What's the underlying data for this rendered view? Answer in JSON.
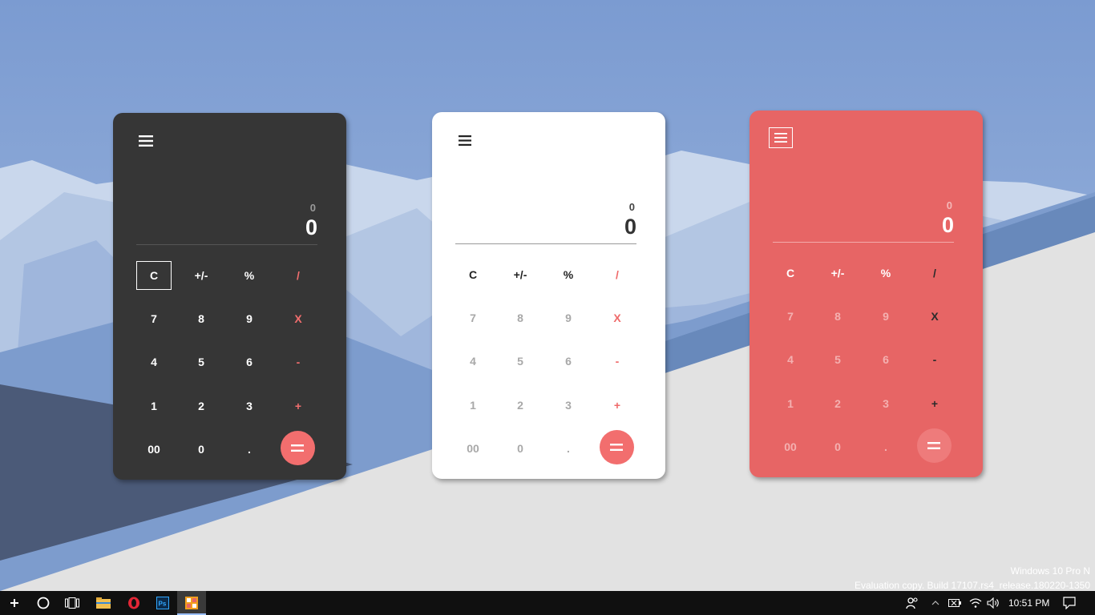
{
  "calculators": [
    {
      "theme": "dark",
      "display": {
        "previous": "0",
        "current": "0"
      },
      "keys": [
        "C",
        "+/-",
        "%",
        "/",
        "7",
        "8",
        "9",
        "X",
        "4",
        "5",
        "6",
        "-",
        "1",
        "2",
        "3",
        "+",
        "00",
        "0",
        "."
      ],
      "colors": {
        "background": "#363636",
        "accent": "#f26e6e"
      }
    },
    {
      "theme": "light",
      "display": {
        "previous": "0",
        "current": "0"
      },
      "keys": [
        "C",
        "+/-",
        "%",
        "/",
        "7",
        "8",
        "9",
        "X",
        "4",
        "5",
        "6",
        "-",
        "1",
        "2",
        "3",
        "+",
        "00",
        "0",
        "."
      ],
      "colors": {
        "background": "#ffffff",
        "accent": "#ef6a6a"
      }
    },
    {
      "theme": "red",
      "display": {
        "previous": "0",
        "current": "0"
      },
      "keys": [
        "C",
        "+/-",
        "%",
        "/",
        "7",
        "8",
        "9",
        "X",
        "4",
        "5",
        "6",
        "-",
        "1",
        "2",
        "3",
        "+",
        "00",
        "0",
        "."
      ],
      "colors": {
        "background": "#e76565",
        "accent": "#ee7b7b"
      }
    }
  ],
  "watermark": {
    "line1": "Windows 10 Pro N",
    "line2": "Evaluation copy. Build 17107.rs4_release.180220-1350"
  },
  "taskbar": {
    "time": "10:51 PM",
    "apps": [
      "plus-icon",
      "cortana-icon",
      "task-view-icon",
      "file-explorer-icon",
      "opera-icon",
      "photoshop-icon",
      "calculator-app-icon"
    ],
    "tray": [
      "people-icon",
      "chevron-up-icon",
      "battery-icon",
      "wifi-icon",
      "volume-icon",
      "action-center-icon"
    ]
  }
}
